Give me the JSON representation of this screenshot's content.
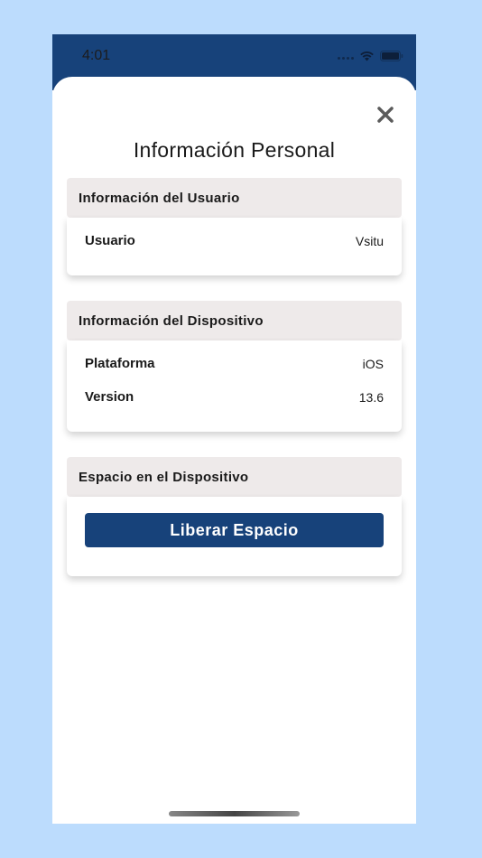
{
  "status_bar": {
    "time": "4:01",
    "icons": [
      "signal-dots-icon",
      "wifi-icon",
      "battery-icon"
    ]
  },
  "colors": {
    "accent": "#17427a",
    "background": "#bcdcfd",
    "section_header_bg": "#eeeaea"
  },
  "modal": {
    "close_icon": "close-icon",
    "title": "Información Personal"
  },
  "sections": {
    "user": {
      "header": "Información del Usuario",
      "rows": [
        {
          "label": "Usuario",
          "value": "Vsitu"
        }
      ]
    },
    "device": {
      "header": "Información del Dispositivo",
      "rows": [
        {
          "label": "Plataforma",
          "value": "iOS"
        },
        {
          "label": "Version",
          "value": "13.6"
        }
      ]
    },
    "storage": {
      "header": "Espacio en el Dispositivo",
      "button_label": "Liberar Espacio"
    }
  }
}
